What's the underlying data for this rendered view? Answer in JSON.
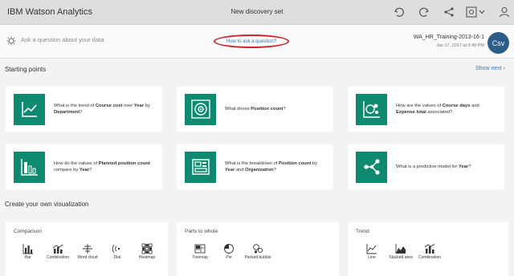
{
  "header": {
    "app_title": "IBM Watson Analytics",
    "document_title": "New discovery set",
    "icons": [
      "undo-icon",
      "redo-icon",
      "share-icon",
      "settings-dropdown-icon",
      "user-icon"
    ]
  },
  "question_bar": {
    "placeholder": "Ask a question about your data",
    "how_to_link": "How to ask a question?",
    "dataset_name": "WA_HR_Training-2013-16-1",
    "dataset_date": "Jan 17, 2017 at 3:49 PM",
    "avatar_label": "Csv"
  },
  "starting_points": {
    "title": "Starting points",
    "show_next": "Show next",
    "cards": [
      {
        "icon": "trend-chart-icon",
        "parts": [
          "What is the trend of ",
          "Course cost",
          " over ",
          "Year",
          " by ",
          "Department",
          "?"
        ]
      },
      {
        "icon": "target-icon",
        "parts": [
          "What drives ",
          "Position count",
          "?"
        ]
      },
      {
        "icon": "bubble-chart-icon",
        "parts": [
          "How are the values of ",
          "Course days",
          " and ",
          "Expense total",
          " associated?"
        ]
      },
      {
        "icon": "bar-chart-icon",
        "parts": [
          "How do the values of ",
          "Planned position count",
          " compare by ",
          "Year",
          "?"
        ]
      },
      {
        "icon": "breakdown-icon",
        "parts": [
          "What is the breakdown of ",
          "Position count",
          " by ",
          "Year",
          " and ",
          "Organization",
          "?"
        ]
      },
      {
        "icon": "predictive-model-icon",
        "parts": [
          "What is a predictive model for ",
          "Year",
          "?"
        ]
      }
    ]
  },
  "create_own": {
    "title": "Create your own visualization",
    "panels": [
      {
        "title": "Comparison",
        "items": [
          "Bar",
          "Combination",
          "Word cloud",
          "Dial",
          "Heatmap"
        ]
      },
      {
        "title": "Parts to whole",
        "items": [
          "Treemap",
          "Pie",
          "Packed bubble"
        ]
      },
      {
        "title": "Trend",
        "items": [
          "Line",
          "Stacked area",
          "Combination"
        ]
      }
    ]
  },
  "colors": {
    "accent": "#0f8a71",
    "link": "#3b73b9",
    "highlight_ring": "#c9252b",
    "avatar": "#2c5c8a"
  }
}
